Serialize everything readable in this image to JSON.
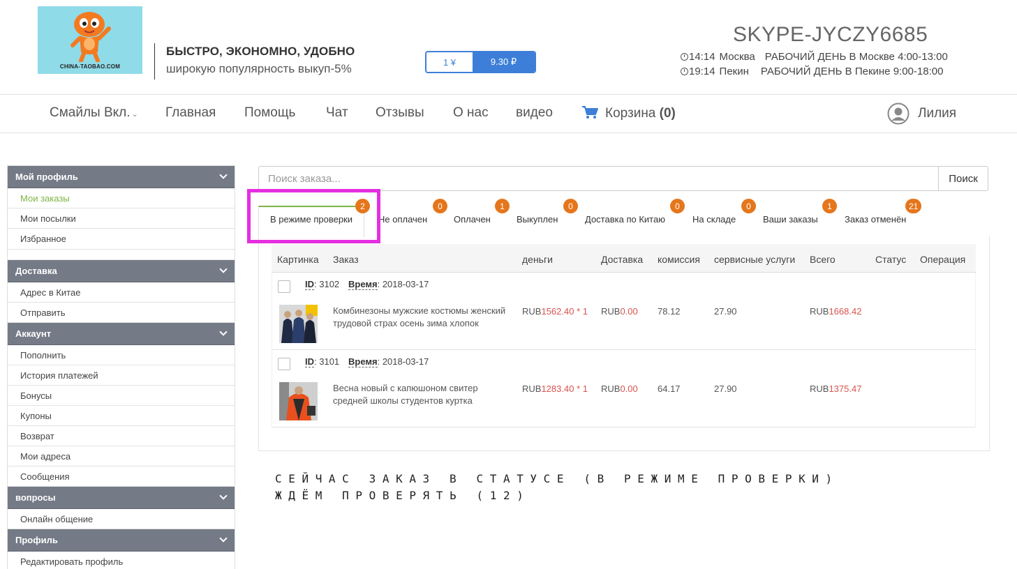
{
  "header": {
    "logo_text": "CHINA-TAOBAO.COM",
    "slogan_main": "БЫСТРО, ЭКОНОМНО, УДОБНО",
    "slogan_sub": "широкую популярность выкуп-5%",
    "rate_left": "1 ¥",
    "rate_right": "9.30 ₽",
    "skype": "SKYPE-JYCZY6685",
    "work_hours": [
      {
        "time": "14:14",
        "city": "Москва",
        "workday": "РАБОЧИЙ ДЕНЬ В Москве 4:00-13:00"
      },
      {
        "time": "19:14",
        "city": "Пекин",
        "workday": "РАБОЧИЙ ДЕНЬ В Пекине 9:00-18:00"
      }
    ]
  },
  "nav": {
    "smiles": "Смайлы Вкл.",
    "home": "Главная",
    "help": "Помощь",
    "chat": "Чат",
    "reviews": "Отзывы",
    "about": "О нас",
    "video": "видео",
    "cart_label": "Корзина",
    "cart_count": "(0)",
    "user": "Лилия"
  },
  "sidebar": {
    "sections": [
      {
        "title": "Мой профиль",
        "items": [
          "Мои заказы",
          "Мои посылки",
          "Избранное"
        ]
      },
      {
        "title": "Доставка",
        "items": [
          "Адрес в Китае",
          "Отправить"
        ]
      },
      {
        "title": "Аккаунт",
        "items": [
          "Пополнить",
          "История платежей",
          "Бонусы",
          "Купоны",
          "Возврат",
          "Мои адреса",
          "Сообщения"
        ]
      },
      {
        "title": "вопросы",
        "items": [
          "Онлайн общение"
        ]
      },
      {
        "title": "Профиль",
        "items": [
          "Редактировать профиль"
        ]
      }
    ]
  },
  "search": {
    "placeholder": "Поиск заказа...",
    "button": "Поиск"
  },
  "tabs": [
    {
      "label": "В режиме проверки",
      "count": "2"
    },
    {
      "label": "Не оплачен",
      "count": "0"
    },
    {
      "label": "Оплачен",
      "count": "1"
    },
    {
      "label": "Выкуплен",
      "count": "0"
    },
    {
      "label": "Доставка по Китаю",
      "count": "0"
    },
    {
      "label": "На складе",
      "count": "0"
    },
    {
      "label": "Ваши заказы",
      "count": "1"
    },
    {
      "label": "Заказ отменён",
      "count": "21"
    }
  ],
  "table": {
    "columns": [
      "Картинка",
      "Заказ",
      "деньги",
      "Доставка",
      "комиссия",
      "сервисные услуги",
      "Всего",
      "Статус",
      "Операция"
    ],
    "id_label": "ID",
    "time_label": "Время",
    "orders": [
      {
        "id": "3102",
        "date": "2018-03-17",
        "title": "Комбинезоны мужские костюмы женский трудовой страх осень зима хлопок",
        "money_currency": "RUB",
        "money_value": "1562.40",
        "qty": " * 1",
        "delivery_currency": "RUB",
        "delivery_value": "0.00",
        "commission": "78.12",
        "service": "27.90",
        "total_currency": "RUB",
        "total_value": "1668.42"
      },
      {
        "id": "3101",
        "date": "2018-03-17",
        "title": "Весна новый с капюшоном свитер средней школы студентов куртка",
        "money_currency": "RUB",
        "money_value": "1283.40",
        "qty": " * 1",
        "delivery_currency": "RUB",
        "delivery_value": "0.00",
        "commission": "64.17",
        "service": "27.90",
        "total_currency": "RUB",
        "total_value": "1375.47"
      }
    ]
  },
  "note": {
    "line1": "СЕЙЧАС ЗАКАЗ В СТАТУСЕ (В РЕЖИМЕ ПРОВЕРКИ)",
    "line2": "ЖДЁМ ПРОВЕРЯТЬ (12)"
  },
  "colors": {
    "accent_blue": "#3d7fd8",
    "active_green": "#7cb342",
    "badge_orange": "#e5761c",
    "highlight_magenta": "#e52ee0",
    "price_red": "#d9534f",
    "sidebar_header": "#747a86"
  }
}
